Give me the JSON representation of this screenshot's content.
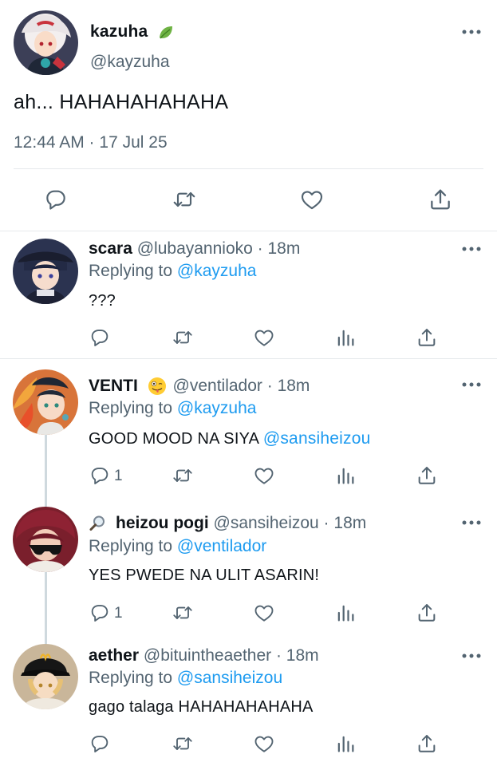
{
  "main_tweet": {
    "name": "kazuha",
    "handle": "@kayzuha",
    "text": "ah... HAHAHAHAHAHA",
    "timestamp": "12:44 AM · 17 Jul 25",
    "badge_icon": "leaf-icon",
    "actions": [
      "reply-icon",
      "retweet-icon",
      "like-icon",
      "share-icon"
    ]
  },
  "replies": [
    {
      "name": "scara",
      "handle": "@lubayannioko · 18m",
      "replying_prefix": "Replying to",
      "replying_to": "@kayzuha",
      "text": "???",
      "reply_count": ""
    },
    {
      "name": "VENTI",
      "name_emoji": "zany-face-emoji",
      "handle": "@ventilador · 18m",
      "replying_prefix": "Replying to",
      "replying_to": "@kayzuha",
      "text": "GOOD MOOD NA SIYA",
      "text_mention": "@sansiheizou",
      "reply_count": "1"
    },
    {
      "name": "heizou pogi",
      "name_icon": "magnifying-glass-icon",
      "handle": "@sansiheizou · 18m",
      "replying_prefix": "Replying to",
      "replying_to": "@ventilador",
      "text": "YES PWEDE NA ULIT ASARIN!",
      "reply_count": "1"
    },
    {
      "name": "aether",
      "handle": "@bituintheaether · 18m",
      "replying_prefix": "Replying to",
      "replying_to": "@sansiheizou",
      "text": "gago talaga HAHAHAHAHAHA",
      "reply_count": ""
    }
  ],
  "colors": {
    "text": "#0f1419",
    "muted": "#536471",
    "link": "#1d9bf0",
    "divider": "#e6e9ec",
    "thread_line": "#cfd9de"
  }
}
